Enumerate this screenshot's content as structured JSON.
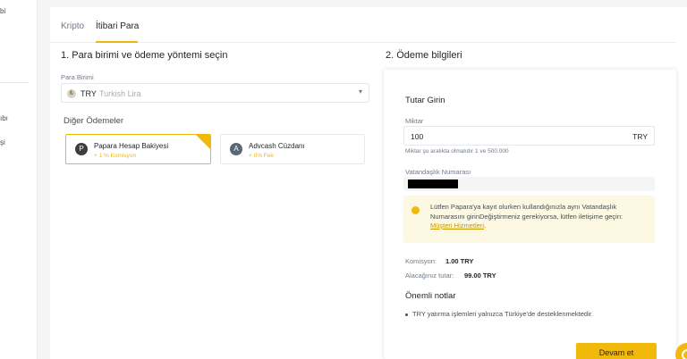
{
  "sidebar": {
    "fragments": [
      "bi",
      "ıbı",
      "şi"
    ]
  },
  "tabs": [
    {
      "label": "Kripto"
    },
    {
      "label": "İtibari Para"
    }
  ],
  "left": {
    "section_title": "1. Para birimi ve ödeme yöntemi seçin",
    "currency_label": "Para Birimi",
    "currency_icon": "₺",
    "currency_code": "TRY",
    "currency_name": "Turkish Lira",
    "other_payments_title": "Diğer Ödemeler",
    "methods": [
      {
        "name": "Papara Hesap Bakiyesi",
        "sub": "+ 1 % Komisyon",
        "icon": "P",
        "selected": true
      },
      {
        "name": "Advcash Cüzdanı",
        "sub": "+ 0% Fee",
        "icon": "A",
        "selected": false
      }
    ]
  },
  "right": {
    "section_title": "2. Ödeme bilgileri",
    "panel_title": "Tutar Girin",
    "amount_label": "Miktar",
    "amount_value": "100",
    "amount_currency": "TRY",
    "amount_hint": "Miktar şu aralıkta olmalıdır 1 ve 500.000",
    "citizen_label": "Vatandaşlık Numarası",
    "notice_text": "Lütfen Papara'ya kayıt olurken kullandığınızla aynı Vatandaşlık Numarasını girinDeğiştirmeniz gerekiyorsa, lütfen iletişime geçin: ",
    "notice_link": "Müşteri Hizmetleri",
    "notice_tail": ".",
    "commission_label": "Komisyon:",
    "commission_value": "1.00 TRY",
    "receive_label": "Alacağınız tutar:",
    "receive_value": "99.00 TRY",
    "notes_title": "Önemli notlar",
    "notes": [
      "TRY yatırma işlemleri yalnızca Türkiye'de desteklenmektedir."
    ],
    "continue_label": "Devam et"
  },
  "colors": {
    "accent": "#f0b90b",
    "notice_bg": "#fdf8e1",
    "link": "#c99400"
  }
}
